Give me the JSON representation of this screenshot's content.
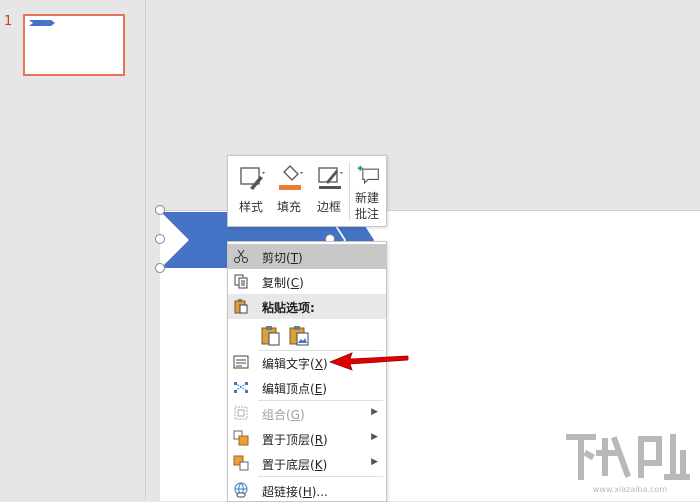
{
  "thumbnails": {
    "slide_number": "1"
  },
  "mini_toolbar": {
    "style_label": "样式",
    "fill_label": "填充",
    "border_label": "边框",
    "new_comment_line1": "新建",
    "new_comment_line2": "批注"
  },
  "context_menu": {
    "items": [
      {
        "label": "剪切",
        "key": "T",
        "icon": "scissors-icon",
        "state": "highlighted"
      },
      {
        "label": "复制",
        "key": "C",
        "icon": "copy-icon",
        "state": "normal"
      },
      {
        "label": "粘贴选项:",
        "key": "",
        "icon": "paste-icon",
        "state": "header"
      },
      {
        "label": "编辑文字",
        "key": "X",
        "icon": "edit-text-icon",
        "state": "normal"
      },
      {
        "label": "编辑顶点",
        "key": "E",
        "icon": "edit-points-icon",
        "state": "normal"
      },
      {
        "label": "组合",
        "key": "G",
        "icon": "group-icon",
        "state": "disabled"
      },
      {
        "label": "置于顶层",
        "key": "R",
        "icon": "bring-to-front-icon",
        "state": "normal"
      },
      {
        "label": "置于底层",
        "key": "K",
        "icon": "send-to-back-icon",
        "state": "normal"
      },
      {
        "label": "超链接",
        "key": "H",
        "icon": "hyperlink-icon",
        "state": "normal"
      }
    ]
  },
  "colors": {
    "accent": "#c43e1c",
    "shape_blue": "#4472c4",
    "fill_orange": "#ed7d31",
    "arrow_red": "#e00000"
  }
}
